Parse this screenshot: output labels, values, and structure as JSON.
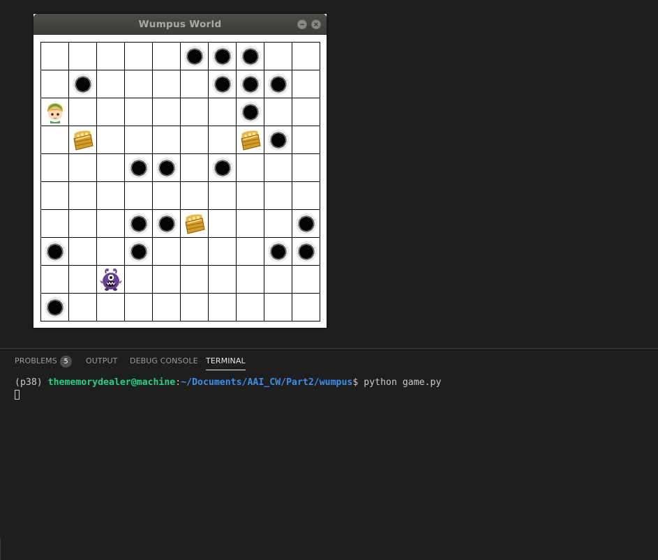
{
  "window": {
    "title": "Wumpus World"
  },
  "board": {
    "rows": 10,
    "cols": 10,
    "cells": [
      [
        "",
        "",
        "",
        "",
        "",
        "pit",
        "pit",
        "pit",
        "",
        ""
      ],
      [
        "",
        "pit",
        "",
        "",
        "",
        "",
        "pit",
        "pit",
        "pit",
        ""
      ],
      [
        "agent",
        "",
        "",
        "",
        "",
        "",
        "",
        "pit",
        "",
        ""
      ],
      [
        "",
        "gold",
        "",
        "",
        "",
        "",
        "",
        "gold",
        "pit",
        ""
      ],
      [
        "",
        "",
        "",
        "pit",
        "pit",
        "",
        "pit",
        "",
        "",
        ""
      ],
      [
        "",
        "",
        "",
        "",
        "",
        "",
        "",
        "",
        "",
        ""
      ],
      [
        "",
        "",
        "",
        "pit",
        "pit",
        "gold",
        "",
        "",
        "",
        "pit"
      ],
      [
        "pit",
        "",
        "",
        "pit",
        "",
        "",
        "",
        "",
        "pit",
        "pit"
      ],
      [
        "",
        "",
        "wumpus",
        "",
        "",
        "",
        "",
        "",
        "",
        ""
      ],
      [
        "pit",
        "",
        "",
        "",
        "",
        "",
        "",
        "",
        "",
        ""
      ]
    ],
    "icons": {
      "pit": "pit-icon",
      "gold": "treasure-chest-icon",
      "agent": "agent-icon",
      "wumpus": "wumpus-monster-icon"
    }
  },
  "panel": {
    "tabs": [
      {
        "label": "PROBLEMS",
        "active": false
      },
      {
        "label": "OUTPUT",
        "active": false
      },
      {
        "label": "DEBUG CONSOLE",
        "active": false
      },
      {
        "label": "TERMINAL",
        "active": true
      }
    ],
    "problems_count": "5"
  },
  "terminal": {
    "env": "(p38) ",
    "user_host": "thememorydealer@machine",
    "colon": ":",
    "path": "~/Documents/AAI_CW/Part2/wumpus",
    "prompt_symbol": "$ ",
    "command": "python game.py"
  },
  "colors": {
    "panel_bg": "#1e1e1e",
    "terminal_user": "#23d18b",
    "terminal_path": "#3b8eea",
    "tab_active": "#e7e7e7",
    "tab_inactive": "#9a9a9a"
  }
}
